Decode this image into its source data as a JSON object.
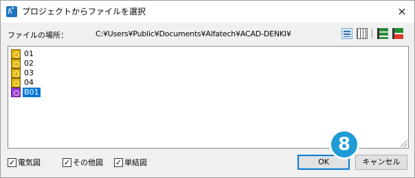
{
  "window": {
    "title": "プロジェクトからファイルを選択",
    "app_icon_glyph": "ﾊﾞ",
    "close_glyph": "×"
  },
  "path": {
    "label": "ファイルの場所：",
    "value": "C:¥Users¥Public¥Documents¥Alfatech¥ACAD-DENKI¥"
  },
  "view_icons": [
    "list-view-icon",
    "detail-view-icon",
    "toolbar-icon-a",
    "toolbar-icon-b"
  ],
  "files": [
    {
      "label": "01",
      "icon": "folder-yellow-icon",
      "selected": false
    },
    {
      "label": "02",
      "icon": "folder-yellow-icon",
      "selected": false
    },
    {
      "label": "03",
      "icon": "folder-yellow-icon",
      "selected": false
    },
    {
      "label": "04",
      "icon": "folder-yellow-icon",
      "selected": false
    },
    {
      "label": "B01",
      "icon": "folder-purple-icon",
      "selected": true
    }
  ],
  "filters": [
    {
      "label": "電気図",
      "checked": true
    },
    {
      "label": "その他図",
      "checked": true
    },
    {
      "label": "単結図",
      "checked": true
    }
  ],
  "buttons": {
    "ok": "OK",
    "cancel": "キャンセル"
  },
  "step_badge": "8",
  "colors": {
    "selection": "#0078d7",
    "badge": "#1f9bd7",
    "folder_yellow": "#e0b300",
    "folder_purple": "#9b3ad0"
  }
}
